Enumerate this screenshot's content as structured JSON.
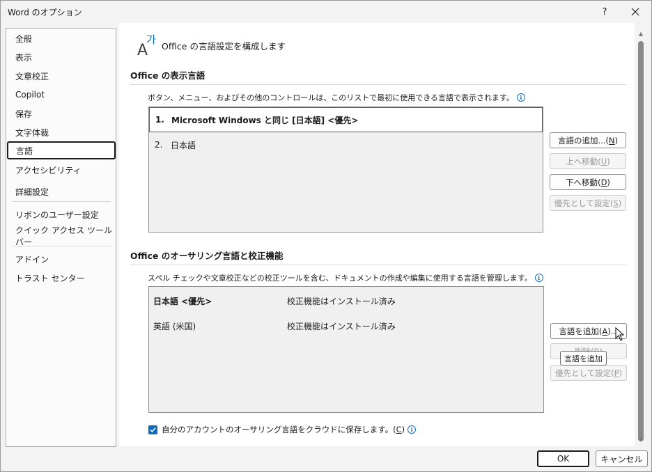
{
  "window": {
    "title": "Word のオプション",
    "help_label": "?",
    "close_label": "✕"
  },
  "sidebar": {
    "items": [
      {
        "label": "全般"
      },
      {
        "label": "表示"
      },
      {
        "label": "文章校正"
      },
      {
        "label": "Copilot"
      },
      {
        "label": "保存"
      },
      {
        "label": "文字体裁"
      },
      {
        "label": "言語",
        "selected": true
      },
      {
        "label": "アクセシビリティ"
      },
      {
        "label": "詳細設定"
      },
      {
        "label": "リボンのユーザー設定"
      },
      {
        "label": "クイック アクセス ツール バー"
      },
      {
        "label": "アドイン"
      },
      {
        "label": "トラスト センター"
      }
    ]
  },
  "header": {
    "text": "Office の言語設定を構成します",
    "icon": "language-icon"
  },
  "display_section": {
    "title": "Office の表示言語",
    "description": "ボタン、メニュー、およびその他のコントロールは、このリストで最初に使用できる言語で表示されます。",
    "languages": [
      {
        "num": "1.",
        "label": "Microsoft Windows と同じ [日本語] <優先>",
        "selected": true
      },
      {
        "num": "2.",
        "label": "日本語"
      }
    ],
    "buttons": {
      "add_pre": "言語の追加...(",
      "add_key": "N",
      "add_post": ")",
      "up_pre": "上へ移動(",
      "up_key": "U",
      "up_post": ")",
      "down_pre": "下へ移動(",
      "down_key": "D",
      "down_post": ")",
      "pref_pre": "優先として設定(",
      "pref_key": "S",
      "pref_post": ")"
    }
  },
  "proofing_section": {
    "title": "Office のオーサリング言語と校正機能",
    "description": "スペル チェックや文章校正などの校正ツールを含む、ドキュメントの作成や編集に使用する言語を管理します。",
    "languages": [
      {
        "label": "日本語 <優先>",
        "status": "校正機能はインストール済み",
        "bold": true
      },
      {
        "label": "英語 (米国)",
        "status": "校正機能はインストール済み"
      }
    ],
    "buttons": {
      "add_pre": "言語を追加(",
      "add_key": "A",
      "add_post": ")...",
      "remove_label": "削除(R)",
      "pref_pre": "優先として設定(",
      "pref_key": "P",
      "pref_post": ")"
    },
    "tooltip": "言語を追加"
  },
  "cloud_checkbox": {
    "checked": true,
    "label_pre": "自分のアカウントのオーサリング言語をクラウドに保存します。(",
    "label_key": "C",
    "label_post": ")"
  },
  "footer": {
    "ok_label": "OK",
    "cancel_label": "キャンセル"
  },
  "info_glyph": "i",
  "colors": {
    "accent": "#0f6cbd",
    "selected_border": "#1b1b1b"
  }
}
